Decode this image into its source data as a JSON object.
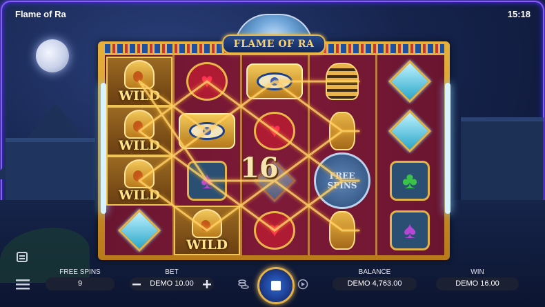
{
  "header": {
    "title": "Flame of Ra",
    "time": "15:18"
  },
  "logo": {
    "text": "FLAME OF RA"
  },
  "reels": {
    "win_display": "16",
    "wild_label": "WILD",
    "scatter_label_line1": "FREE",
    "scatter_label_line2": "SPINS"
  },
  "hud": {
    "free_spins_label": "FREE SPINS",
    "free_spins_value": "9",
    "bet_label": "BET",
    "bet_value": "DEMO 10.00",
    "balance_label": "BALANCE",
    "balance_value": "DEMO 4,763.00",
    "win_label": "WIN",
    "win_value": "DEMO 16.00"
  },
  "colors": {
    "accent_gold": "#e3b24a",
    "frame_glow": "#8a5cff",
    "reel_bg": "#7e1a38"
  },
  "icons": {
    "calendar": "calendar-icon",
    "menu": "menu-icon",
    "minus": "minus-icon",
    "plus": "plus-icon",
    "coins": "coins-icon",
    "autoplay": "autoplay-icon",
    "spin": "stop-icon"
  }
}
